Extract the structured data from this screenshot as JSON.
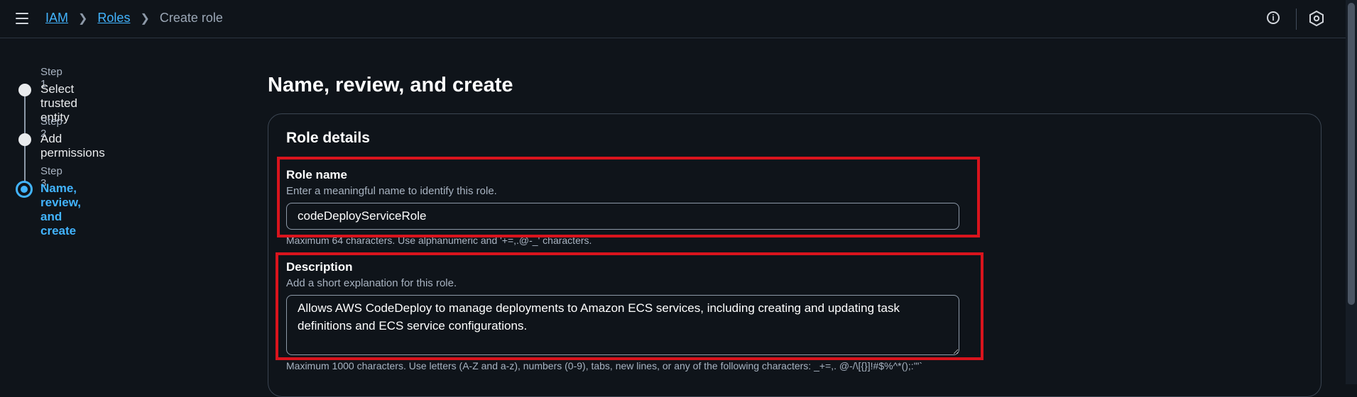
{
  "breadcrumb": {
    "items": [
      {
        "label": "IAM"
      },
      {
        "label": "Roles"
      },
      {
        "label": "Create role"
      }
    ]
  },
  "header_icons": {
    "menu": "hamburger-icon",
    "info": "info-icon",
    "settings": "hexagon-icon"
  },
  "steps": [
    {
      "number": "Step 1",
      "name": "Select trusted entity",
      "state": "completed"
    },
    {
      "number": "Step 2",
      "name": "Add permissions",
      "state": "completed"
    },
    {
      "number": "Step 3",
      "name": "Name, review, and create",
      "state": "active"
    }
  ],
  "page": {
    "title": "Name, review, and create"
  },
  "role_details": {
    "title": "Role details",
    "role_name": {
      "label": "Role name",
      "hint": "Enter a meaningful name to identify this role.",
      "value": "codeDeployServiceRole",
      "constraint": "Maximum 64 characters. Use alphanumeric and '+=,.@-_' characters."
    },
    "description": {
      "label": "Description",
      "hint": "Add a short explanation for this role.",
      "value": "Allows AWS CodeDeploy to manage deployments to Amazon ECS services, including creating and updating task definitions and ECS service configurations.",
      "constraint": "Maximum 1000 characters. Use letters (A-Z and a-z), numbers (0-9), tabs, new lines, or any of the following characters: _+=,. @-/\\[{}]!#$%^*();:'\"`"
    }
  },
  "colors": {
    "background": "#0f141a",
    "accent": "#42b4ff",
    "highlight": "#d9141d"
  }
}
